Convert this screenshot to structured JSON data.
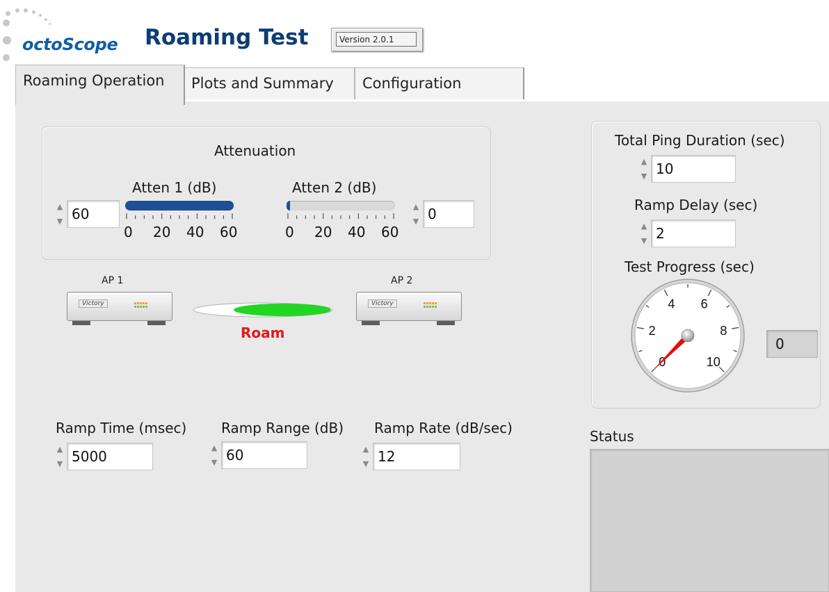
{
  "header": {
    "logo": "octoScope",
    "title": "Roaming Test",
    "version": "Version 2.0.1"
  },
  "tabs": [
    {
      "label": "Roaming Operation",
      "active": true
    },
    {
      "label": "Plots and Summary",
      "active": false
    },
    {
      "label": "Configuration",
      "active": false
    }
  ],
  "attenuation": {
    "title": "Attenuation",
    "atten1": {
      "label": "Atten 1  (dB)",
      "value": "60",
      "level": 60,
      "max": 60
    },
    "atten2": {
      "label": "Atten 2  (dB)",
      "value": "0",
      "level": 0,
      "max": 60
    },
    "scale": [
      "0",
      "20",
      "40",
      "60"
    ]
  },
  "aps": {
    "ap1": {
      "label": "AP 1",
      "brand": "Victory"
    },
    "ap2": {
      "label": "AP 2",
      "brand": "Victory"
    },
    "roam_label": "Roam",
    "roam_color": "#e21a1a",
    "indicator_color": "#22d622"
  },
  "ramp": {
    "time": {
      "label": "Ramp Time (msec)",
      "value": "5000"
    },
    "range": {
      "label": "Ramp Range (dB)",
      "value": "60"
    },
    "rate": {
      "label": "Ramp Rate (dB/sec)",
      "value": "12"
    }
  },
  "right_panel": {
    "ping": {
      "label": "Total Ping Duration (sec)",
      "value": "10"
    },
    "delay": {
      "label": "Ramp Delay (sec)",
      "value": "2"
    },
    "progress": {
      "label": "Test Progress (sec)",
      "value": 0,
      "readout": "0",
      "scale": [
        "0",
        "2",
        "4",
        "6",
        "8",
        "10"
      ],
      "needle_color": "#e01010"
    }
  },
  "status": {
    "label": "Status"
  },
  "icons": {
    "spinner_up": "triangle-up-icon",
    "spinner_down": "triangle-down-icon",
    "ap": "wireless-router-icon",
    "gauge": "dial-gauge-icon"
  }
}
